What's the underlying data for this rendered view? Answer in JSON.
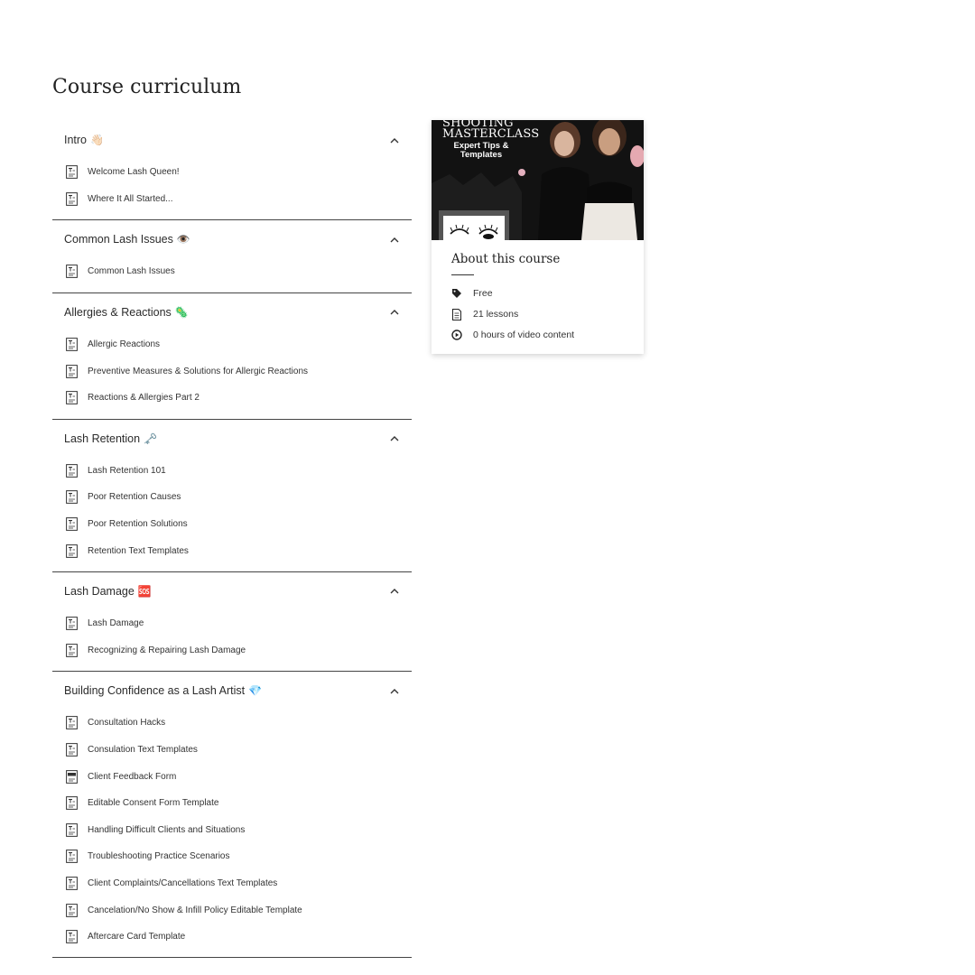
{
  "page": {
    "title": "Course curriculum"
  },
  "sections": [
    {
      "title": "Intro",
      "emoji": "👋🏻",
      "lessons": [
        "Welcome Lash Queen!",
        "Where It All Started..."
      ]
    },
    {
      "title": "Common Lash Issues",
      "emoji": "👁️",
      "lessons": [
        "Common Lash Issues"
      ]
    },
    {
      "title": "Allergies & Reactions",
      "emoji": "🦠",
      "lessons": [
        "Allergic Reactions",
        "Preventive Measures & Solutions for Allergic Reactions",
        "Reactions & Allergies Part 2"
      ]
    },
    {
      "title": "Lash Retention",
      "emoji": "🗝️",
      "lessons": [
        "Lash Retention 101",
        "Poor Retention Causes",
        "Poor Retention Solutions",
        "Retention Text Templates"
      ]
    },
    {
      "title": "Lash Damage",
      "emoji": "🆘",
      "lessons": [
        "Lash Damage",
        "Recognizing & Repairing Lash Damage"
      ]
    },
    {
      "title": "Building Confidence as a Lash Artist",
      "emoji": "💎",
      "lessons": [
        "Consultation Hacks",
        "Consulation Text Templates",
        "Client Feedback Form",
        "Editable Consent Form Template",
        "Handling Difficult Clients and Situations",
        "Troubleshooting Practice Scenarios",
        "Client Complaints/Cancellations Text Templates",
        "Cancelation/No Show & Infill Policy Editable Template",
        "Aftercare Card Template"
      ]
    }
  ],
  "icons": {
    "section_toggle": "chevron-up-icon",
    "lesson": "text-document-icon",
    "lesson_pdf": "pdf-document-icon"
  },
  "card": {
    "thumbnail": {
      "title_line1": "SHOOTING",
      "title_line2": "MASTERCLASS",
      "subtitle_line1": "Expert Tips &",
      "subtitle_line2": "Templates"
    },
    "about_title": "About this course",
    "price": "Free",
    "lessons_count": "21 lessons",
    "video": "0 hours of video content"
  }
}
